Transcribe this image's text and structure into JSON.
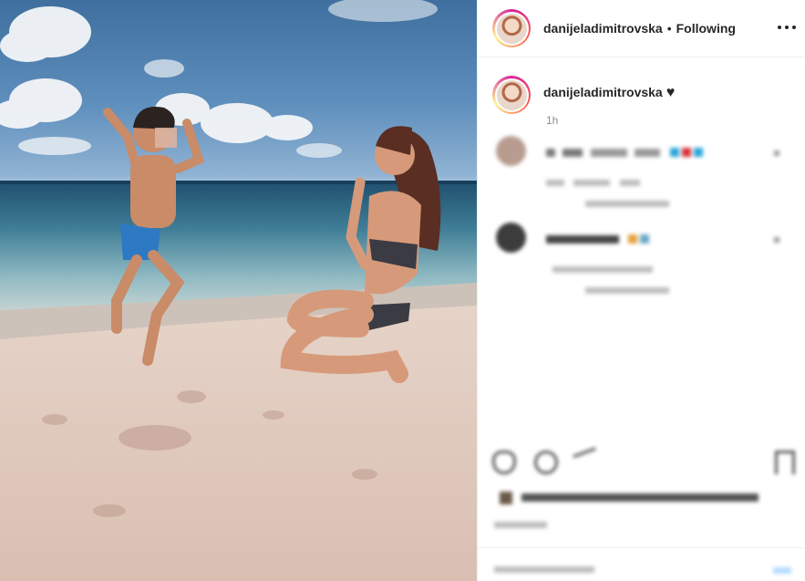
{
  "post": {
    "username": "danijeladimitrovska",
    "separator": "•",
    "follow_status": "Following",
    "caption_text": "♥",
    "time_ago": "1h"
  },
  "icons": {
    "more": "more-options-icon",
    "like": "heart-icon",
    "comment": "comment-icon",
    "share": "share-icon",
    "save": "bookmark-icon"
  },
  "colors": {
    "text": "#262626",
    "muted": "#8e8e8e",
    "divider": "#efefef",
    "story_ring": "#d6249f"
  }
}
